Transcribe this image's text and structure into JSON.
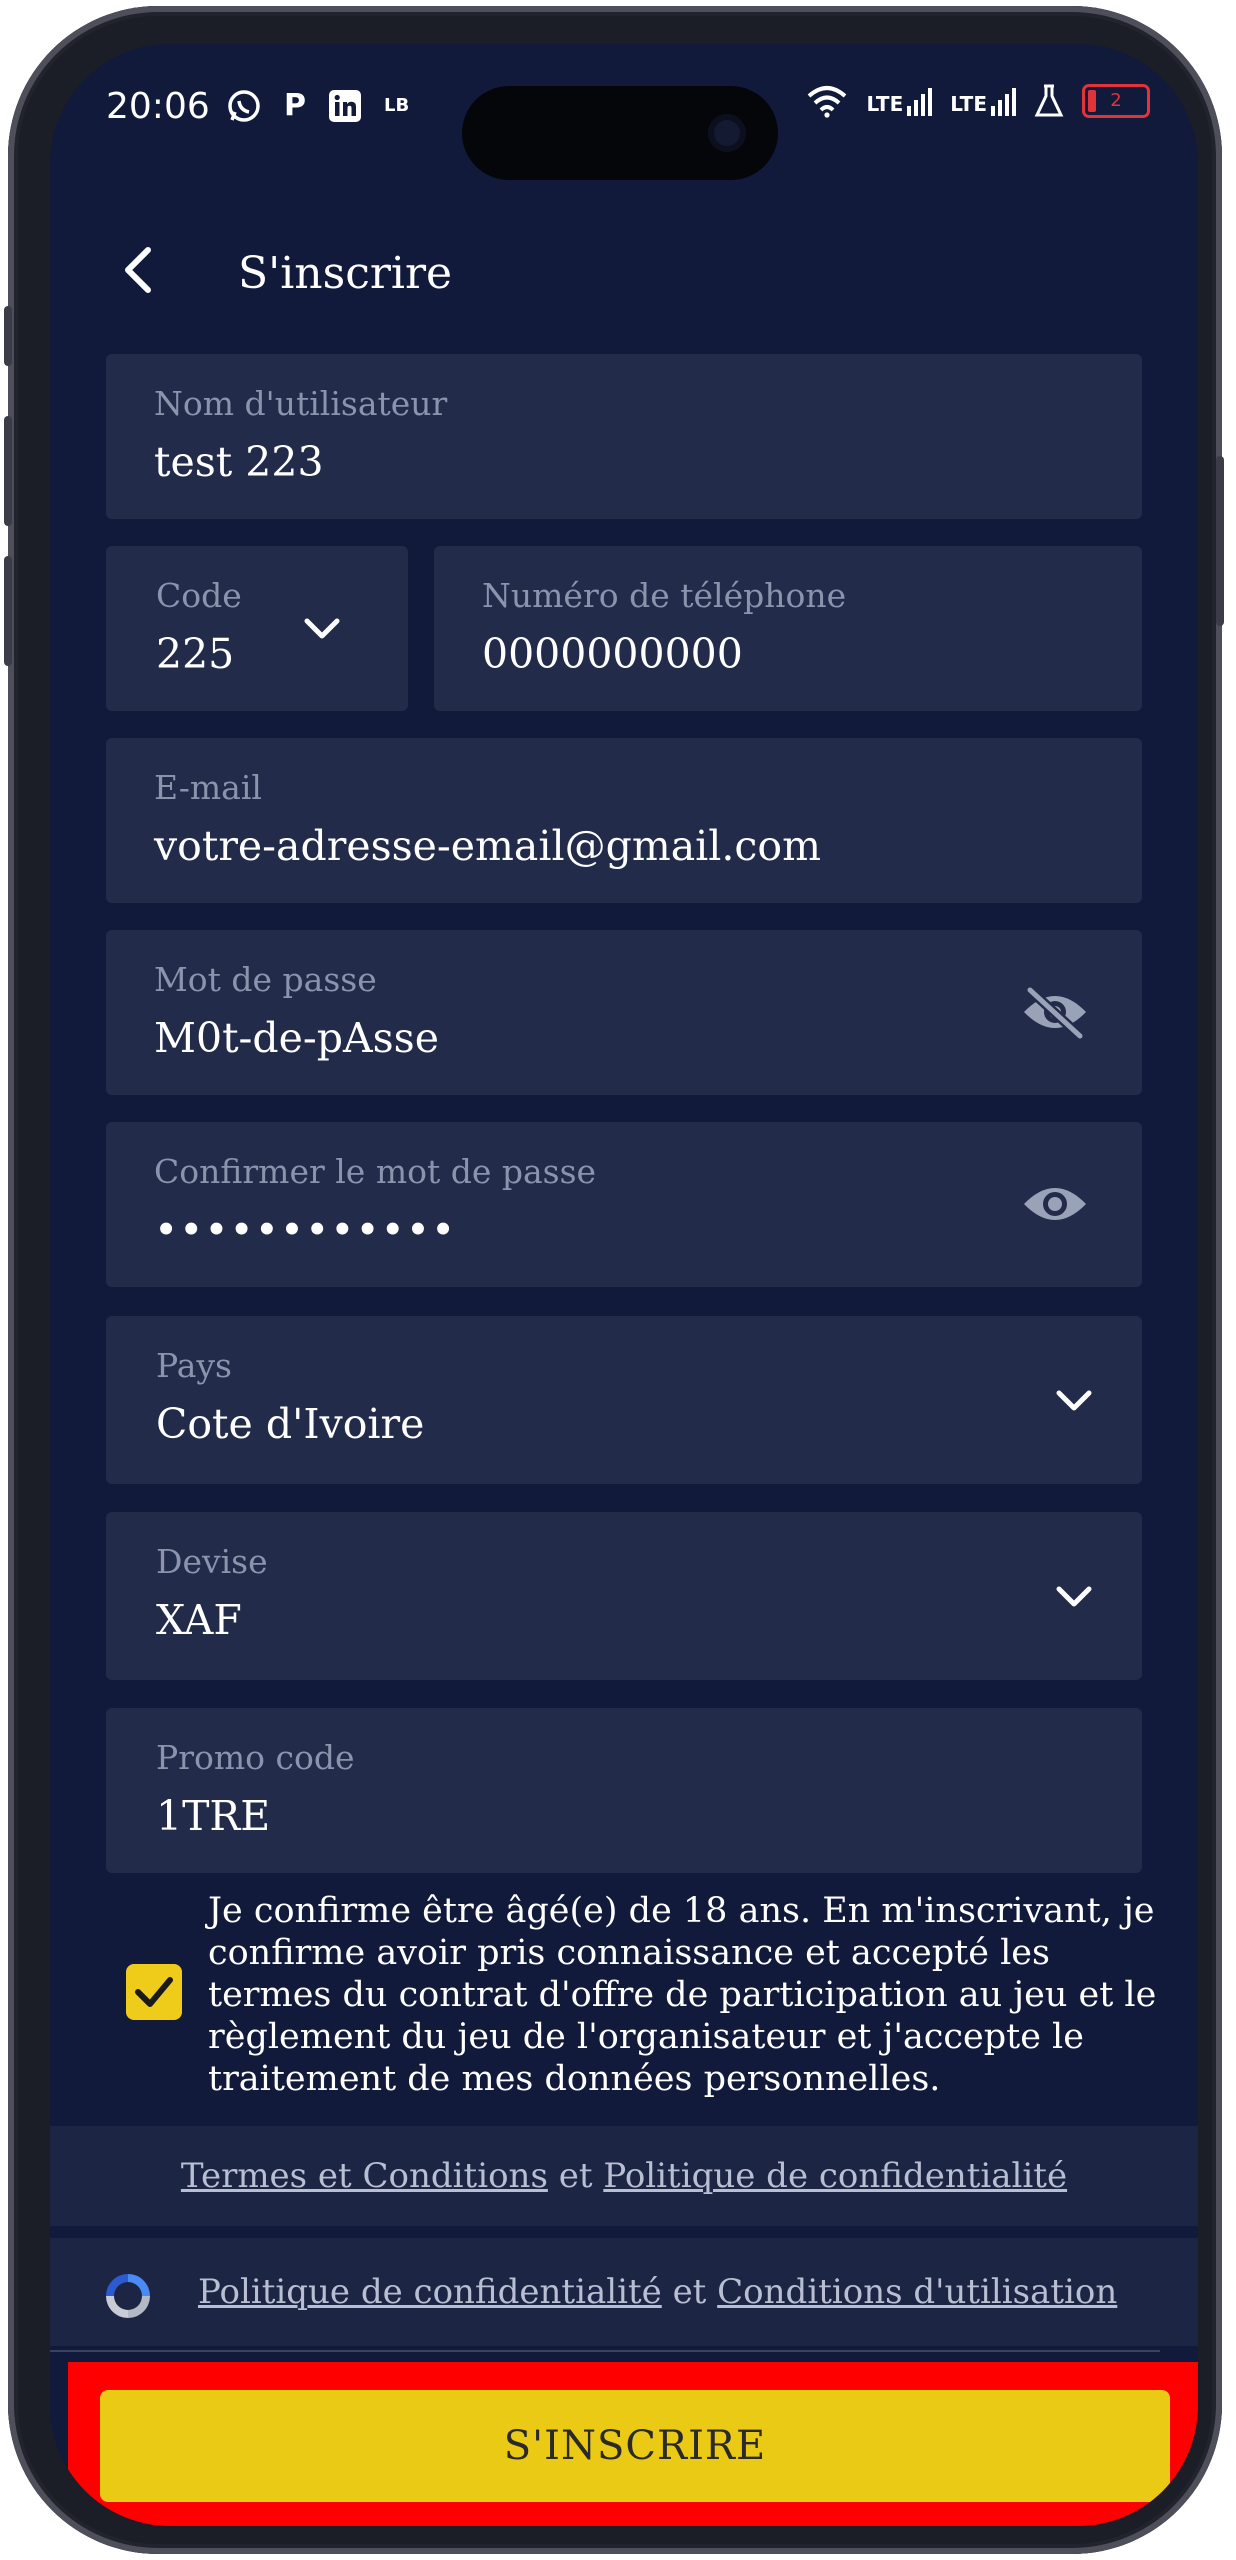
{
  "status_bar": {
    "time": "20:06",
    "left_icons": [
      "whatsapp-icon",
      "p-icon",
      "linkedin-icon",
      "lb-icon"
    ],
    "lte1": "LTE",
    "lte2": "LTE",
    "battery_level": "2"
  },
  "header": {
    "title": "S'inscrire"
  },
  "form": {
    "username": {
      "label": "Nom d'utilisateur",
      "value": "test 223"
    },
    "code": {
      "label": "Code",
      "value": "225"
    },
    "phone": {
      "label": "Numéro de téléphone",
      "value": "0000000000"
    },
    "email": {
      "label": "E-mail",
      "value": "votre-adresse-email@gmail.com"
    },
    "password": {
      "label": "Mot de passe",
      "value": "M0t-de-pAsse"
    },
    "confirm_password": {
      "label": "Confirmer le mot de passe",
      "value": "••••••••••••"
    },
    "country": {
      "label": "Pays",
      "value": "Cote d'Ivoire"
    },
    "currency": {
      "label": "Devise",
      "value": "XAF"
    },
    "promo": {
      "label": "Promo code",
      "value": "1TRE"
    }
  },
  "consent": {
    "checked": true,
    "text": "Je confirme être âgé(e) de 18 ans. En m'inscrivant, je confirme avoir pris connaissance et accepté les termes du contrat d'offre de participation au jeu et le règlement du jeu de l'organisateur et j'accepte le traitement de mes données personnelles."
  },
  "links": {
    "terms": "Termes et Conditions",
    "and1": "et",
    "privacy": "Politique de confidentialité",
    "recaptcha_privacy": "Politique de confidentialité",
    "and2": "et",
    "recaptcha_terms": "Conditions d'utilisation"
  },
  "submit": {
    "label": "S'INSCRIRE"
  },
  "colors": {
    "background": "#121a3c",
    "field": "#232b4a",
    "accent": "#ebca16",
    "highlight": "#ff0000"
  }
}
